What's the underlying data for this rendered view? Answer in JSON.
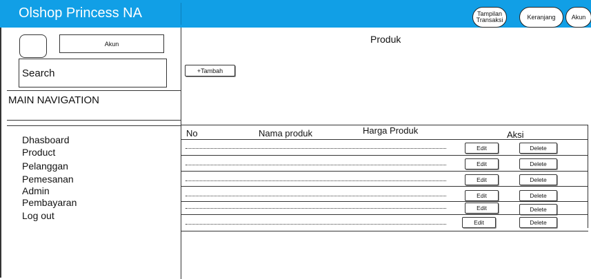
{
  "app": {
    "title": "Olshop Princess NA"
  },
  "header": {
    "buttons": [
      {
        "line1": "Tampilan",
        "line2": "Transaksi"
      },
      {
        "label": "Keranjang"
      },
      {
        "label": "Akun"
      }
    ]
  },
  "sidebar": {
    "account_label": "Akun",
    "search_placeholder": "Search",
    "nav_heading": "MAIN NAVIGATION",
    "items": [
      {
        "label": "Dhasboard"
      },
      {
        "label": "Product"
      },
      {
        "label": "Pelanggan"
      },
      {
        "label": "Pemesanan"
      },
      {
        "label": "Admin"
      },
      {
        "label": "Pembayaran"
      },
      {
        "label": "Log out"
      }
    ]
  },
  "main": {
    "title": "Produk",
    "add_button": "+Tambah",
    "table": {
      "headers": {
        "no": "No",
        "name": "Nama produk",
        "price": "Harga Produk",
        "actions": "Aksi"
      },
      "rows": [
        {
          "edit": "Edit",
          "delete": "Delete"
        },
        {
          "edit": "Edit",
          "delete": "Delete"
        },
        {
          "edit": "Edit",
          "delete": "Delete"
        },
        {
          "edit": "Edit",
          "delete": "Delete"
        },
        {
          "edit": "Edit",
          "delete": "Delete"
        },
        {
          "edit": "Edit",
          "delete": "Delete"
        }
      ]
    }
  },
  "colors": {
    "accent": "#119fe6",
    "border": "#333333",
    "background": "#ffffff"
  }
}
